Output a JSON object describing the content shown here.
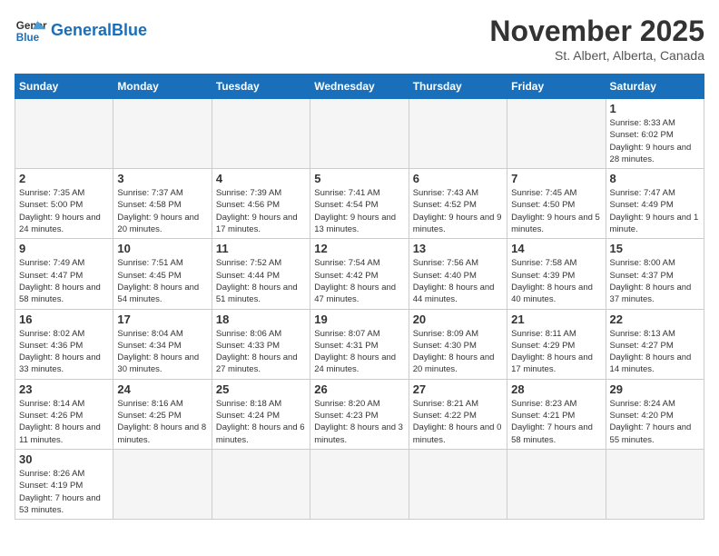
{
  "logo": {
    "text_general": "General",
    "text_blue": "Blue"
  },
  "header": {
    "month": "November 2025",
    "location": "St. Albert, Alberta, Canada"
  },
  "days_of_week": [
    "Sunday",
    "Monday",
    "Tuesday",
    "Wednesday",
    "Thursday",
    "Friday",
    "Saturday"
  ],
  "weeks": [
    [
      {
        "day": "",
        "info": ""
      },
      {
        "day": "",
        "info": ""
      },
      {
        "day": "",
        "info": ""
      },
      {
        "day": "",
        "info": ""
      },
      {
        "day": "",
        "info": ""
      },
      {
        "day": "",
        "info": ""
      },
      {
        "day": "1",
        "info": "Sunrise: 8:33 AM\nSunset: 6:02 PM\nDaylight: 9 hours and 28 minutes."
      }
    ],
    [
      {
        "day": "2",
        "info": "Sunrise: 7:35 AM\nSunset: 5:00 PM\nDaylight: 9 hours and 24 minutes."
      },
      {
        "day": "3",
        "info": "Sunrise: 7:37 AM\nSunset: 4:58 PM\nDaylight: 9 hours and 20 minutes."
      },
      {
        "day": "4",
        "info": "Sunrise: 7:39 AM\nSunset: 4:56 PM\nDaylight: 9 hours and 17 minutes."
      },
      {
        "day": "5",
        "info": "Sunrise: 7:41 AM\nSunset: 4:54 PM\nDaylight: 9 hours and 13 minutes."
      },
      {
        "day": "6",
        "info": "Sunrise: 7:43 AM\nSunset: 4:52 PM\nDaylight: 9 hours and 9 minutes."
      },
      {
        "day": "7",
        "info": "Sunrise: 7:45 AM\nSunset: 4:50 PM\nDaylight: 9 hours and 5 minutes."
      },
      {
        "day": "8",
        "info": "Sunrise: 7:47 AM\nSunset: 4:49 PM\nDaylight: 9 hours and 1 minute."
      }
    ],
    [
      {
        "day": "9",
        "info": "Sunrise: 7:49 AM\nSunset: 4:47 PM\nDaylight: 8 hours and 58 minutes."
      },
      {
        "day": "10",
        "info": "Sunrise: 7:51 AM\nSunset: 4:45 PM\nDaylight: 8 hours and 54 minutes."
      },
      {
        "day": "11",
        "info": "Sunrise: 7:52 AM\nSunset: 4:44 PM\nDaylight: 8 hours and 51 minutes."
      },
      {
        "day": "12",
        "info": "Sunrise: 7:54 AM\nSunset: 4:42 PM\nDaylight: 8 hours and 47 minutes."
      },
      {
        "day": "13",
        "info": "Sunrise: 7:56 AM\nSunset: 4:40 PM\nDaylight: 8 hours and 44 minutes."
      },
      {
        "day": "14",
        "info": "Sunrise: 7:58 AM\nSunset: 4:39 PM\nDaylight: 8 hours and 40 minutes."
      },
      {
        "day": "15",
        "info": "Sunrise: 8:00 AM\nSunset: 4:37 PM\nDaylight: 8 hours and 37 minutes."
      }
    ],
    [
      {
        "day": "16",
        "info": "Sunrise: 8:02 AM\nSunset: 4:36 PM\nDaylight: 8 hours and 33 minutes."
      },
      {
        "day": "17",
        "info": "Sunrise: 8:04 AM\nSunset: 4:34 PM\nDaylight: 8 hours and 30 minutes."
      },
      {
        "day": "18",
        "info": "Sunrise: 8:06 AM\nSunset: 4:33 PM\nDaylight: 8 hours and 27 minutes."
      },
      {
        "day": "19",
        "info": "Sunrise: 8:07 AM\nSunset: 4:31 PM\nDaylight: 8 hours and 24 minutes."
      },
      {
        "day": "20",
        "info": "Sunrise: 8:09 AM\nSunset: 4:30 PM\nDaylight: 8 hours and 20 minutes."
      },
      {
        "day": "21",
        "info": "Sunrise: 8:11 AM\nSunset: 4:29 PM\nDaylight: 8 hours and 17 minutes."
      },
      {
        "day": "22",
        "info": "Sunrise: 8:13 AM\nSunset: 4:27 PM\nDaylight: 8 hours and 14 minutes."
      }
    ],
    [
      {
        "day": "23",
        "info": "Sunrise: 8:14 AM\nSunset: 4:26 PM\nDaylight: 8 hours and 11 minutes."
      },
      {
        "day": "24",
        "info": "Sunrise: 8:16 AM\nSunset: 4:25 PM\nDaylight: 8 hours and 8 minutes."
      },
      {
        "day": "25",
        "info": "Sunrise: 8:18 AM\nSunset: 4:24 PM\nDaylight: 8 hours and 6 minutes."
      },
      {
        "day": "26",
        "info": "Sunrise: 8:20 AM\nSunset: 4:23 PM\nDaylight: 8 hours and 3 minutes."
      },
      {
        "day": "27",
        "info": "Sunrise: 8:21 AM\nSunset: 4:22 PM\nDaylight: 8 hours and 0 minutes."
      },
      {
        "day": "28",
        "info": "Sunrise: 8:23 AM\nSunset: 4:21 PM\nDaylight: 7 hours and 58 minutes."
      },
      {
        "day": "29",
        "info": "Sunrise: 8:24 AM\nSunset: 4:20 PM\nDaylight: 7 hours and 55 minutes."
      }
    ],
    [
      {
        "day": "30",
        "info": "Sunrise: 8:26 AM\nSunset: 4:19 PM\nDaylight: 7 hours and 53 minutes."
      },
      {
        "day": "",
        "info": ""
      },
      {
        "day": "",
        "info": ""
      },
      {
        "day": "",
        "info": ""
      },
      {
        "day": "",
        "info": ""
      },
      {
        "day": "",
        "info": ""
      },
      {
        "day": "",
        "info": ""
      }
    ]
  ]
}
